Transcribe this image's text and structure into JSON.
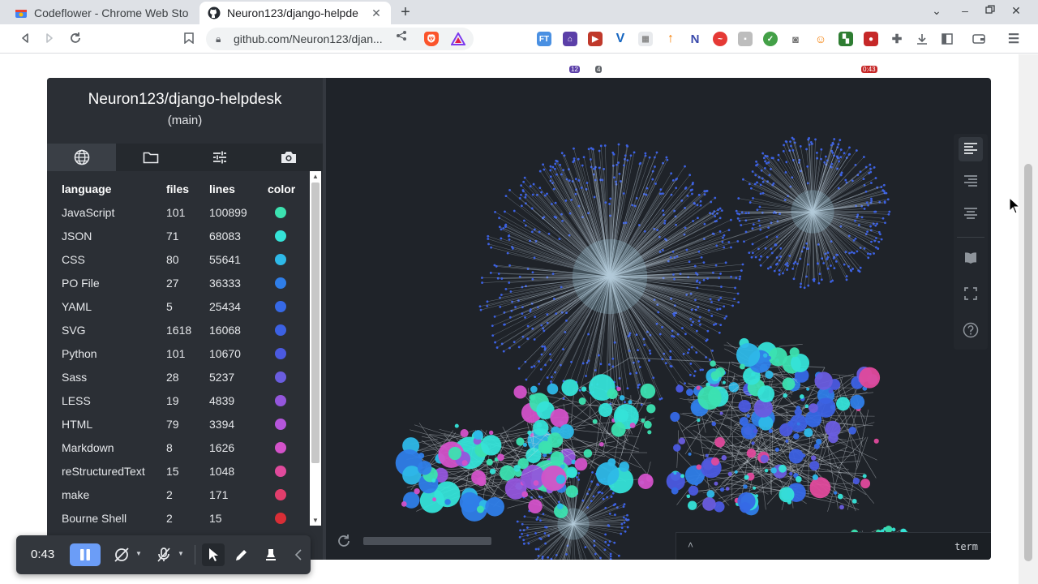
{
  "browser": {
    "tabs": [
      {
        "title": "Codeflower - Chrome Web Sto",
        "active": false
      },
      {
        "title": "Neuron123/django-helpde",
        "active": true
      }
    ],
    "url": "github.com/Neuron123/djan...",
    "window_controls": [
      "chevron-down",
      "minimize",
      "restore",
      "close"
    ],
    "extension_badges": [
      "12",
      "4",
      "0:43"
    ]
  },
  "app": {
    "repo_title": "Neuron123/django-helpdesk",
    "branch": "(main)",
    "side_tabs": [
      "globe-icon",
      "folder-icon",
      "sliders-icon",
      "camera-icon"
    ],
    "table": {
      "headers": {
        "language": "language",
        "files": "files",
        "lines": "lines",
        "color": "color"
      },
      "rows": [
        {
          "language": "JavaScript",
          "files": "101",
          "lines": "100899",
          "color": "#3ce2b0"
        },
        {
          "language": "JSON",
          "files": "71",
          "lines": "68083",
          "color": "#35e3d8"
        },
        {
          "language": "CSS",
          "files": "80",
          "lines": "55641",
          "color": "#2eb9e8"
        },
        {
          "language": "PO File",
          "files": "27",
          "lines": "36333",
          "color": "#2f7ee8"
        },
        {
          "language": "YAML",
          "files": "5",
          "lines": "25434",
          "color": "#3669e6"
        },
        {
          "language": "SVG",
          "files": "1618",
          "lines": "16068",
          "color": "#3c61e3"
        },
        {
          "language": "Python",
          "files": "101",
          "lines": "10670",
          "color": "#4b5ae0"
        },
        {
          "language": "Sass",
          "files": "28",
          "lines": "5237",
          "color": "#6a5ddf"
        },
        {
          "language": "LESS",
          "files": "19",
          "lines": "4839",
          "color": "#9456dc"
        },
        {
          "language": "HTML",
          "files": "79",
          "lines": "3394",
          "color": "#b556dc"
        },
        {
          "language": "Markdown",
          "files": "8",
          "lines": "1626",
          "color": "#d352c9"
        },
        {
          "language": "reStructuredText",
          "files": "15",
          "lines": "1048",
          "color": "#e04a9c"
        },
        {
          "language": "make",
          "files": "2",
          "lines": "171",
          "color": "#e23e6c"
        },
        {
          "language": "Bourne Shell",
          "files": "2",
          "lines": "15",
          "color": "#d92e36"
        }
      ]
    },
    "right_panel": [
      "align-left-icon",
      "align-right-icon",
      "align-center-icon",
      "book-icon",
      "fullscreen-icon",
      "help-icon"
    ],
    "term_label": "term"
  },
  "recorder": {
    "time": "0:43"
  }
}
